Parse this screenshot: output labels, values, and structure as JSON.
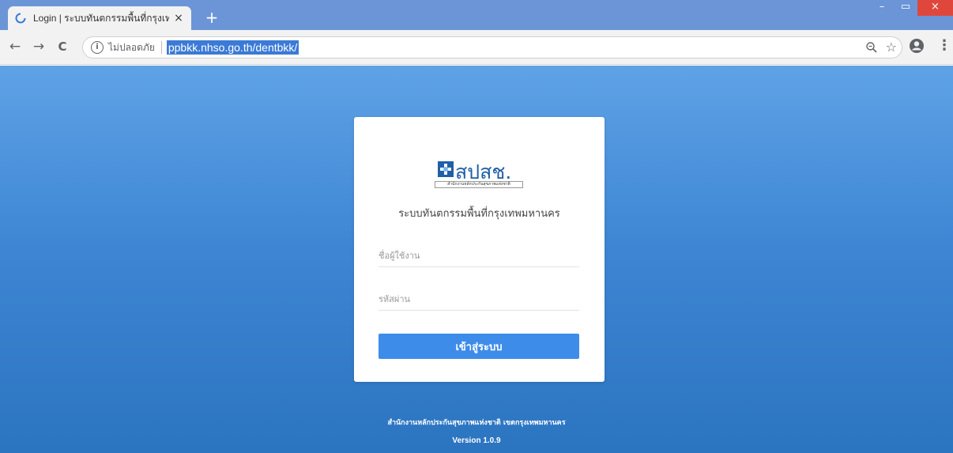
{
  "browser": {
    "tab_title": "Login | ระบบทันตกรรมพื้นที่กรุงเทพมหา",
    "tab_close": "×",
    "new_tab": "+",
    "win_minimize": "–",
    "win_maximize": "▭",
    "win_close": "×",
    "back": "←",
    "forward": "→",
    "reload": "C",
    "security_label": "ไม่ปลอดภัย",
    "url": "ppbkk.nhso.go.th/dentbkk/",
    "star": "☆",
    "menu": "⋮"
  },
  "page": {
    "logo_text": "สปสช.",
    "logo_sub": "สำนักงานหลักประกันสุขภาพแห่งชาติ",
    "system_title": "ระบบทันตกรรมพื้นที่กรุงเทพมหานคร",
    "username_placeholder": "ชื่อผู้ใช้งาน",
    "password_placeholder": "รหัสผ่าน",
    "login_button": "เข้าสู่ระบบ",
    "footer_org": "สำนักงานหลักประกันสุขภาพแห่งชาติ เขตกรุงเทพมหานคร",
    "footer_version": "Version 1.0.9"
  },
  "colors": {
    "tab_bar": "#6b95d6",
    "page_gradient_top": "#5fa2e6",
    "page_gradient_bottom": "#2b74c0",
    "login_button": "#3e8cea",
    "logo": "#1f5fa8"
  }
}
